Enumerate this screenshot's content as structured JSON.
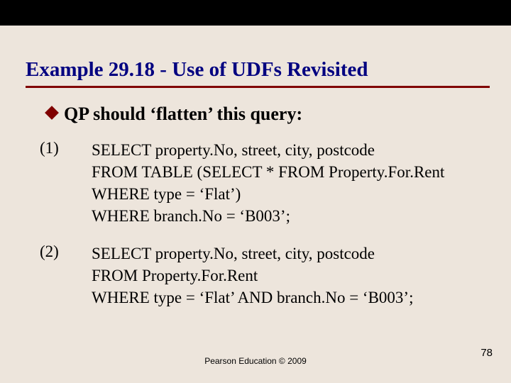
{
  "title": "Example 29.18 - Use of UDFs Revisited",
  "bullet": {
    "text": "QP should ‘flatten’ this query:"
  },
  "items": [
    {
      "num": "(1)",
      "lines": [
        "SELECT property.No, street, city, postcode",
        "FROM TABLE (SELECT * FROM Property.For.Rent WHERE type = ‘Flat’)",
        "WHERE branch.No = ‘B003’;"
      ]
    },
    {
      "num": "(2)",
      "lines": [
        "SELECT property.No, street, city, postcode",
        "FROM Property.For.Rent",
        "WHERE type = ‘Flat’ AND branch.No = ‘B003’;"
      ]
    }
  ],
  "footer": {
    "copyright": "Pearson Education © 2009",
    "page": "78"
  }
}
